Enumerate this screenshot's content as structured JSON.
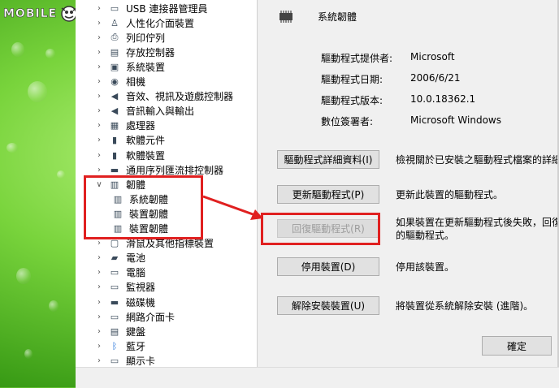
{
  "watermark": {
    "text": "MOBILE",
    "icon": "mascot-icon"
  },
  "tree": {
    "items": [
      {
        "label": "USB 連接器管理員",
        "icon": "usb-connector-icon",
        "expanded": false
      },
      {
        "label": "人性化介面裝置",
        "icon": "hid-icon",
        "expanded": false
      },
      {
        "label": "列印佇列",
        "icon": "printer-icon",
        "expanded": false
      },
      {
        "label": "存放控制器",
        "icon": "storage-controller-icon",
        "expanded": false
      },
      {
        "label": "系統裝置",
        "icon": "system-device-icon",
        "expanded": false
      },
      {
        "label": "相機",
        "icon": "camera-icon",
        "expanded": false
      },
      {
        "label": "音效、視訊及遊戲控制器",
        "icon": "speaker-icon",
        "expanded": false
      },
      {
        "label": "音訊輸入與輸出",
        "icon": "audio-io-icon",
        "expanded": false
      },
      {
        "label": "處理器",
        "icon": "processor-icon",
        "expanded": false
      },
      {
        "label": "軟體元件",
        "icon": "software-component-icon",
        "expanded": false
      },
      {
        "label": "軟體裝置",
        "icon": "software-device-icon",
        "expanded": false
      },
      {
        "label": "通用序列匯流排控制器",
        "icon": "usb-controller-icon",
        "expanded": false
      },
      {
        "label": "韌體",
        "icon": "firmware-icon",
        "expanded": true
      },
      {
        "label": "系統韌體",
        "icon": "firmware-icon",
        "child": true
      },
      {
        "label": "裝置韌體",
        "icon": "firmware-icon",
        "child": true
      },
      {
        "label": "裝置韌體",
        "icon": "firmware-icon",
        "child": true
      },
      {
        "label": "滑鼠及其他指標裝置",
        "icon": "mouse-icon",
        "expanded": false
      },
      {
        "label": "電池",
        "icon": "battery-icon",
        "expanded": false
      },
      {
        "label": "電腦",
        "icon": "computer-icon",
        "expanded": false
      },
      {
        "label": "監視器",
        "icon": "monitor-icon",
        "expanded": false
      },
      {
        "label": "磁碟機",
        "icon": "disk-drive-icon",
        "expanded": false
      },
      {
        "label": "網路介面卡",
        "icon": "network-adapter-icon",
        "expanded": false
      },
      {
        "label": "鍵盤",
        "icon": "keyboard-icon",
        "expanded": false
      },
      {
        "label": "藍牙",
        "icon": "bluetooth-icon",
        "expanded": false
      },
      {
        "label": "顯示卡",
        "icon": "display-adapter-icon",
        "expanded": false
      }
    ]
  },
  "dialog": {
    "device_name": "系統韌體",
    "props": [
      {
        "key": "驅動程式提供者:",
        "value": "Microsoft"
      },
      {
        "key": "驅動程式日期:",
        "value": "2006/6/21"
      },
      {
        "key": "驅動程式版本:",
        "value": "10.0.18362.1"
      },
      {
        "key": "數位簽署者:",
        "value": "Microsoft Windows"
      }
    ],
    "actions": [
      {
        "label": "驅動程式詳細資料(I)",
        "desc": "檢視關於已安裝之驅動程式檔案的詳細",
        "desc2": "",
        "disabled": false
      },
      {
        "label": "更新驅動程式(P)",
        "desc": "更新此裝置的驅動程式。",
        "desc2": "",
        "disabled": false
      },
      {
        "label": "回復驅動程式(R)",
        "desc": "如果裝置在更新驅動程式後失敗，回復",
        "desc2": "的驅動程式。",
        "disabled": true
      },
      {
        "label": "停用裝置(D)",
        "desc": "停用該裝置。",
        "desc2": "",
        "disabled": false
      },
      {
        "label": "解除安裝裝置(U)",
        "desc": "將裝置從系統解除安裝 (進階)。",
        "desc2": "",
        "disabled": false
      }
    ],
    "ok_label": "確定"
  },
  "colors": {
    "highlight": "#e02020",
    "arrow": "#e02020"
  }
}
